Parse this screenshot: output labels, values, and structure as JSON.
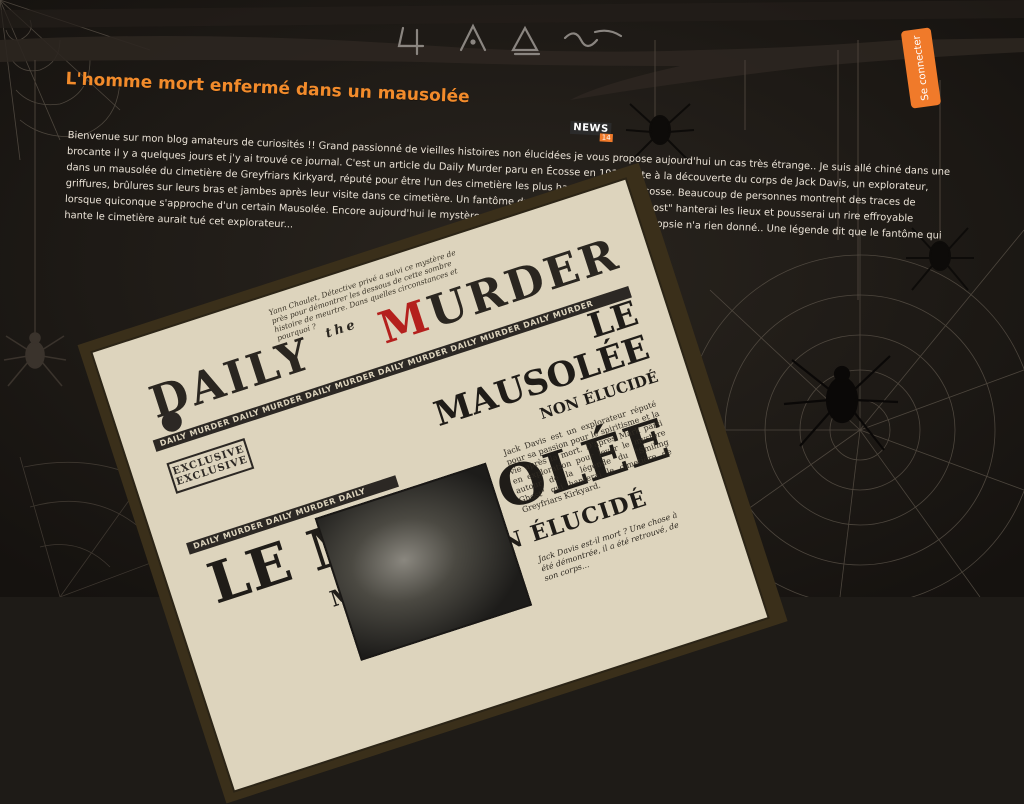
{
  "header": {
    "logo_name": "cryptic-glyph-logo",
    "login_label": "Se connecter"
  },
  "article": {
    "title": "L'homme mort enfermé dans un mausolée",
    "badge_label": "NEWS",
    "badge_number": "14",
    "body": "Bienvenue sur mon blog amateurs de curiosités !! Grand passionné de vieilles histoires non élucidées je vous propose aujourd'hui un cas très étrange.. Je suis allé chiné dans une brocante il y a quelques jours et j'y ai trouvé ce journal. C'est un article du Daily Murder paru en Écosse en 1939 suite à la découverte du corps de Jack Davis, un explorateur, dans un mausolée du cimetière de Greyfriars Kirkyard, réputé pour être l'un des cimetière les plus hanté de toute l'Ecosse. Beaucoup de personnes montrent des traces de griffures, brûlures sur leurs bras et jambes après leur visite dans ce cimetière. Un fantôme du nom de \"The Smiling Ghost\" hanterai les lieux et pousserai un rire effroyable lorsque quiconque s'approche d'un certain Mausolée. Encore aujourd'hui le mystère de cette mort est inexpliquée L'autopsie n'a rien donné.. Une légende dit que le fantôme qui hante le cimetière aurait tué cet explorateur..."
  },
  "newspaper": {
    "masthead_left": "DAILY",
    "masthead_the": "the",
    "masthead_m": "M",
    "masthead_rest": "URDER",
    "strip_text": "DAILY MURDER DAILY MURDER DAILY MURDER DAILY MURDER DAILY MURDER DAILY MURDER",
    "strip_text_2": "DAILY MURDER DAILY MURDER DAILY",
    "exclusive_1": "EXCLUSIVE",
    "exclusive_2": "EXCLUSIVE",
    "headline_main": "LE MAUSOLÉE",
    "headline_sub": "NON ÉLUCIDÉ",
    "headline_big": "LE MAUSOLÉE",
    "headline_mystery": "MYSTÈRE NON ÉLUCIDÉ",
    "intro_text": "Yann Choulet, Détective privé a suivi ce mystère de près pour démontrer les dessous de cette sombre histoire de meurtre. Dans quelles circonstances et pourquoi ?",
    "col_text": "Jack Davis est un explorateur réputé pour sa passion pour le spiritisme et la vie après la mort. D'après Mark parti en exploration pour lever le mystère autour de la légende du \"Smiling Ghost\" qui hanterai le cimetière de Greyfriars Kirkyard.",
    "caption": "Jack Davis est-il mort ? Une chose à été démontrée, il a été retrouvé, de son corps..."
  }
}
